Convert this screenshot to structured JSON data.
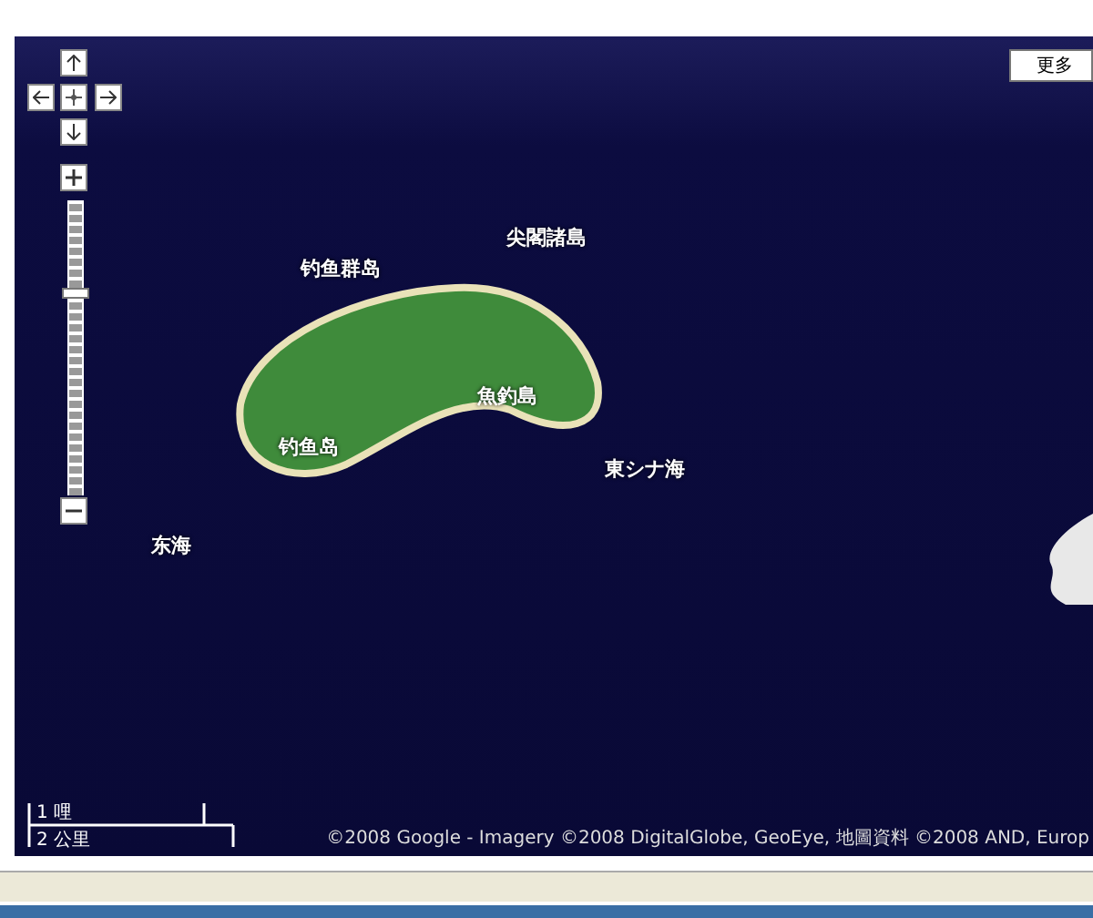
{
  "map": {
    "more_button": "更多",
    "labels": [
      {
        "text": "钓鱼群岛"
      },
      {
        "text": "尖閣諸島"
      },
      {
        "text": "魚釣島"
      },
      {
        "text": "钓鱼岛"
      },
      {
        "text": "東シナ海"
      },
      {
        "text": "东海"
      }
    ],
    "zoom_slider": {
      "level": 0.69
    },
    "scale": {
      "imperial": "1 哩",
      "metric": "2 公里"
    },
    "attribution": "©2008 Google - Imagery ©2008 DigitalGlobe, GeoEye, 地圖資料 ©2008 AND, Europ"
  }
}
